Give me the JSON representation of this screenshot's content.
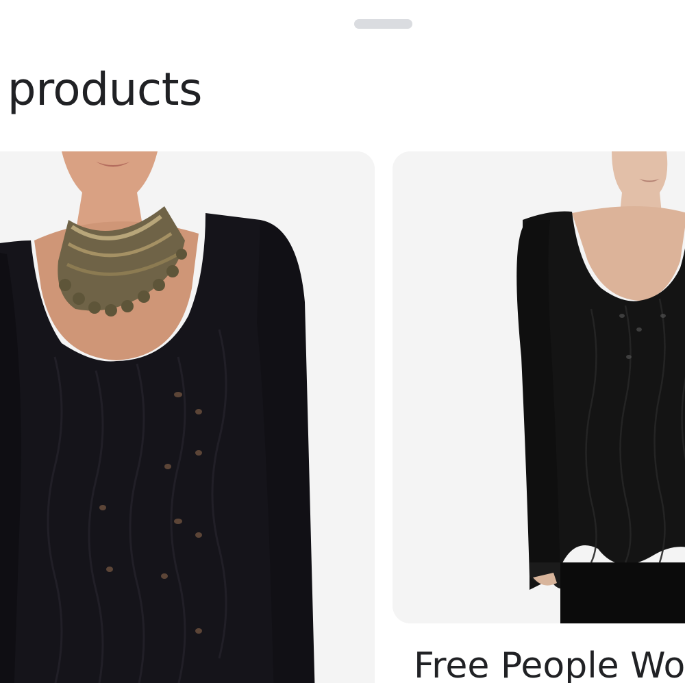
{
  "sheet": {
    "section_title": "ilar products"
  },
  "products": [
    {
      "image_desc": "black-v-neck-knit-sweater-with-necklace",
      "title": ""
    },
    {
      "image_desc": "black-v-neck-knit-sweater",
      "title": "Free People Wo"
    }
  ],
  "colors": {
    "background": "#ffffff",
    "card_bg": "#f4f4f4",
    "handle": "#dadce0",
    "text": "#202124",
    "sweater": "#15141a"
  }
}
